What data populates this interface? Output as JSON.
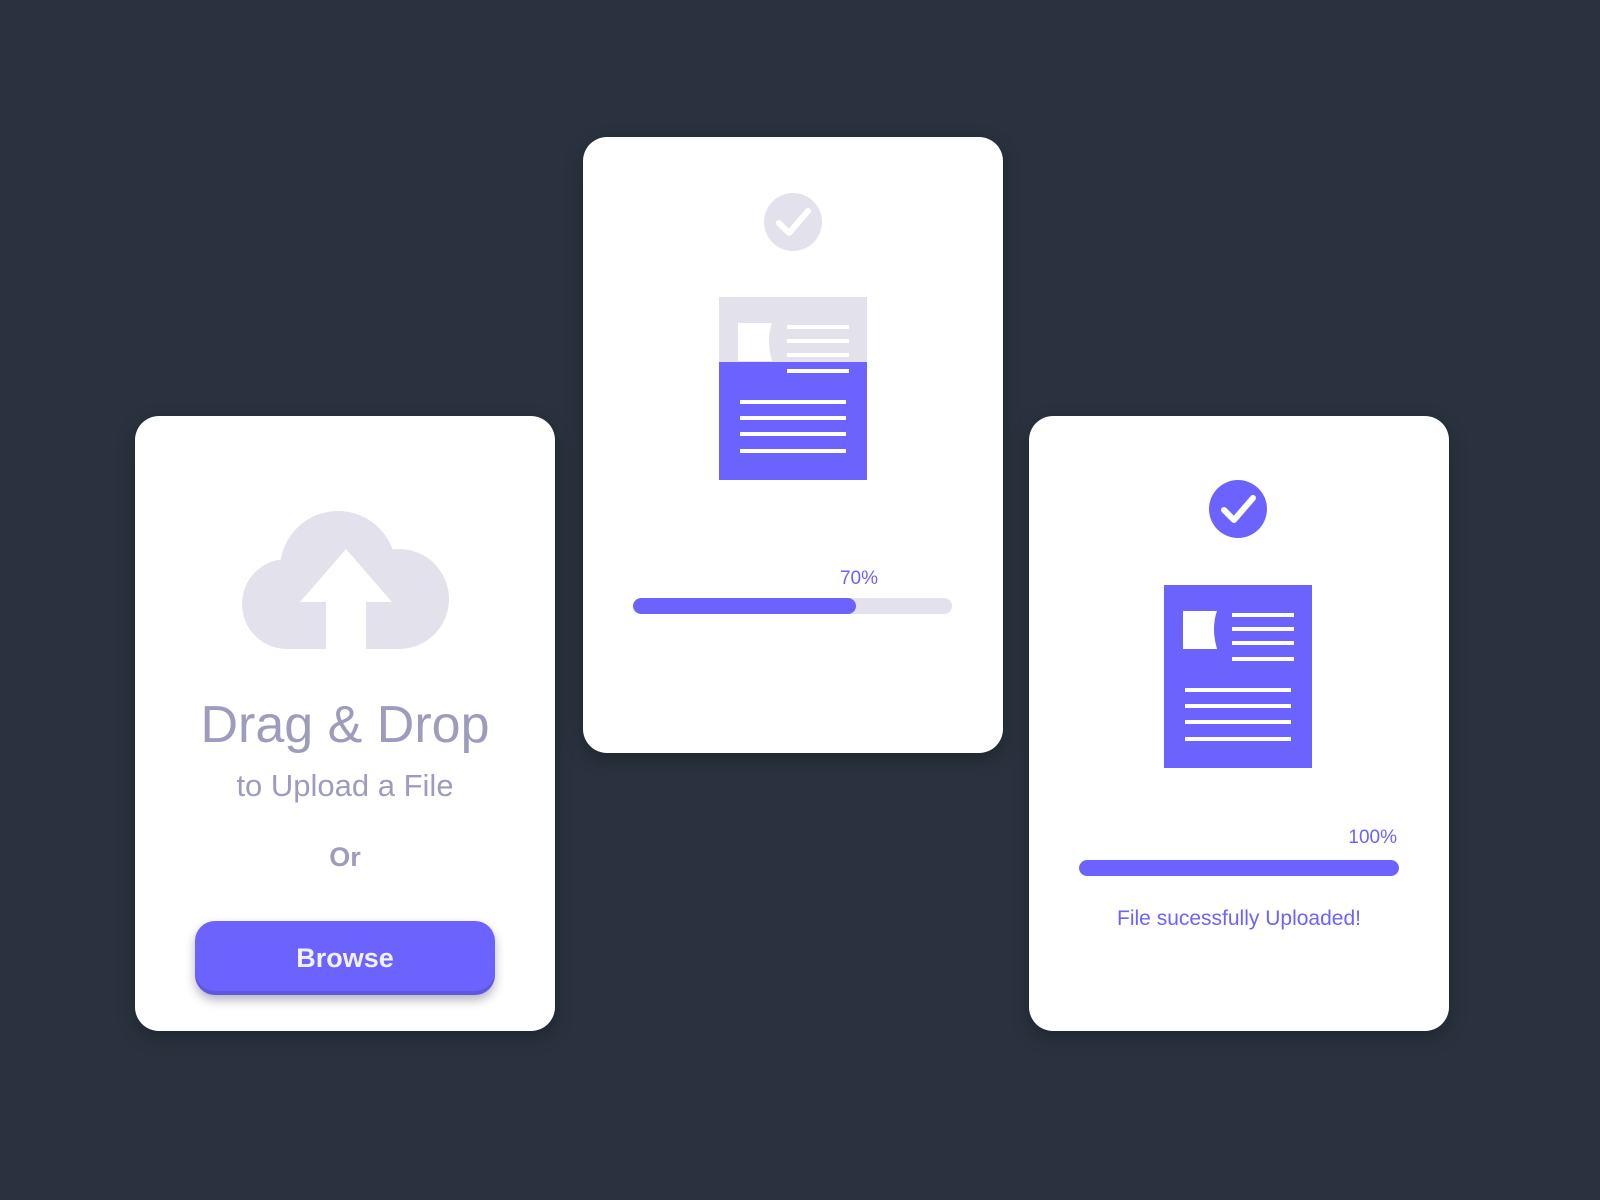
{
  "colors": {
    "background": "#29323e",
    "card": "#ffffff",
    "accent": "#6c63ff",
    "muted": "#e2e1ec",
    "muted_text": "#9e9cbd"
  },
  "upload_card": {
    "icon": "cloud-upload-icon",
    "title": "Drag & Drop",
    "subtitle": "to Upload a File",
    "or_label": "Or",
    "browse_label": "Browse"
  },
  "progress_card": {
    "check_icon": "check-circle-icon",
    "document_icon": "document-icon",
    "progress": 0.7,
    "percent_label": "70%"
  },
  "done_card": {
    "check_icon": "check-circle-icon",
    "document_icon": "document-icon",
    "progress": 1.0,
    "percent_label": "100%",
    "message": "File sucessfully Uploaded!"
  }
}
